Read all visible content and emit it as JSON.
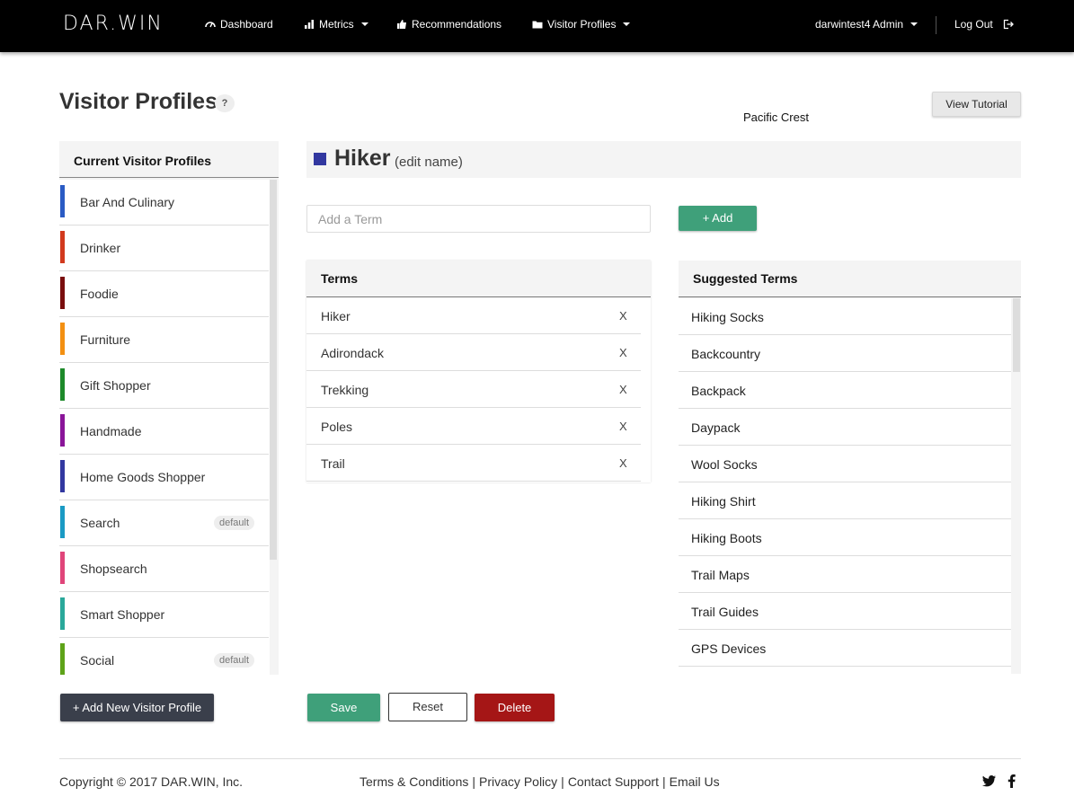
{
  "navbar": {
    "logo": "DAR.WIN",
    "items": [
      {
        "label": "Dashboard",
        "icon": "gauge-icon"
      },
      {
        "label": "Metrics",
        "icon": "bar-chart-icon"
      },
      {
        "label": "Recommendations",
        "icon": "thumbs-up-icon"
      },
      {
        "label": "Visitor Profiles",
        "icon": "folder-icon"
      }
    ],
    "user_menu": "darwintest4 Admin",
    "logout": "Log Out"
  },
  "page": {
    "title": "Visitor Profiles",
    "help": "?",
    "tutorial_button": "View Tutorial",
    "account_name": "Pacific Crest"
  },
  "profiles": {
    "header": "Current Visitor Profiles",
    "items": [
      {
        "name": "Bar And Culinary",
        "color": "#2a5bc4",
        "tag": ""
      },
      {
        "name": "Drinker",
        "color": "#d23a1e",
        "tag": ""
      },
      {
        "name": "Foodie",
        "color": "#7a0e0e",
        "tag": ""
      },
      {
        "name": "Furniture",
        "color": "#f39012",
        "tag": ""
      },
      {
        "name": "Gift Shopper",
        "color": "#1d8a2a",
        "tag": ""
      },
      {
        "name": "Handmade",
        "color": "#8a1599",
        "tag": ""
      },
      {
        "name": "Home Goods Shopper",
        "color": "#3238a0",
        "tag": ""
      },
      {
        "name": "Search",
        "color": "#1a9ac4",
        "tag": "default"
      },
      {
        "name": "Shopsearch",
        "color": "#e0457a",
        "tag": ""
      },
      {
        "name": "Smart Shopper",
        "color": "#2aa89a",
        "tag": ""
      },
      {
        "name": "Social",
        "color": "#5ea319",
        "tag": "default"
      }
    ],
    "add_button": "+ Add New Visitor Profile"
  },
  "editor": {
    "profile_name": "Hiker",
    "swatch_color": "#3238a0",
    "edit_link": "(edit name)",
    "input_placeholder": "Add a Term",
    "add_button": "+ Add",
    "terms_header": "Terms",
    "terms": [
      "Hiker",
      "Adirondack",
      "Trekking",
      "Poles",
      "Trail"
    ],
    "remove_label": "X",
    "suggested_header": "Suggested Terms",
    "suggested": [
      "Hiking Socks",
      "Backcountry",
      "Backpack",
      "Daypack",
      "Wool Socks",
      "Hiking Shirt",
      "Hiking Boots",
      "Trail Maps",
      "Trail Guides",
      "GPS Devices"
    ],
    "save": "Save",
    "reset": "Reset",
    "delete": "Delete"
  },
  "footer": {
    "copyright": "Copyright © 2017 DAR.WIN, Inc.",
    "links": [
      "Terms & Conditions",
      "Privacy Policy",
      "Contact Support",
      "Email Us"
    ],
    "social": [
      "twitter-icon",
      "facebook-icon"
    ]
  }
}
